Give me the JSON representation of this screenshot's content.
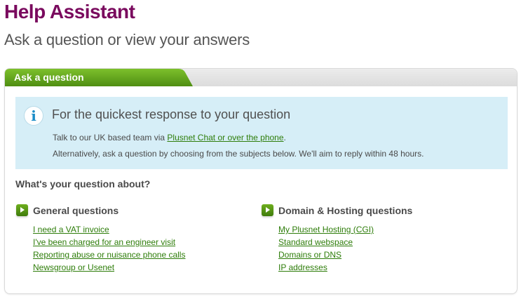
{
  "page": {
    "title": "Help Assistant",
    "subtitle": "Ask a question or view your answers"
  },
  "panel": {
    "tab_label": "Ask a question"
  },
  "info": {
    "icon": "info-icon",
    "icon_glyph": "i",
    "title": "For the quickest response to your question",
    "line1_prefix": "Talk to our UK based team via ",
    "line1_link": "Plusnet Chat or over the phone",
    "line1_suffix": ".",
    "line2": "Alternatively, ask a question by choosing from the subjects below. We'll aim to reply within 48 hours."
  },
  "question_heading": "What's your question about?",
  "categories": [
    {
      "title": "General questions",
      "links": [
        "I need a VAT invoice",
        "I've been charged for an engineer visit",
        "Reporting abuse or nuisance phone calls",
        "Newsgroup or Usenet"
      ]
    },
    {
      "title": "Domain & Hosting questions",
      "links": [
        "My Plusnet Hosting (CGI)",
        "Standard webspace",
        "Domains or DNS",
        "IP addresses"
      ]
    }
  ],
  "colors": {
    "brand_title": "#7a0a5e",
    "tab_green": "#5fa11c",
    "link_green": "#2e7d0a",
    "info_bg": "#d6eef7",
    "info_icon": "#1a8cc7"
  }
}
